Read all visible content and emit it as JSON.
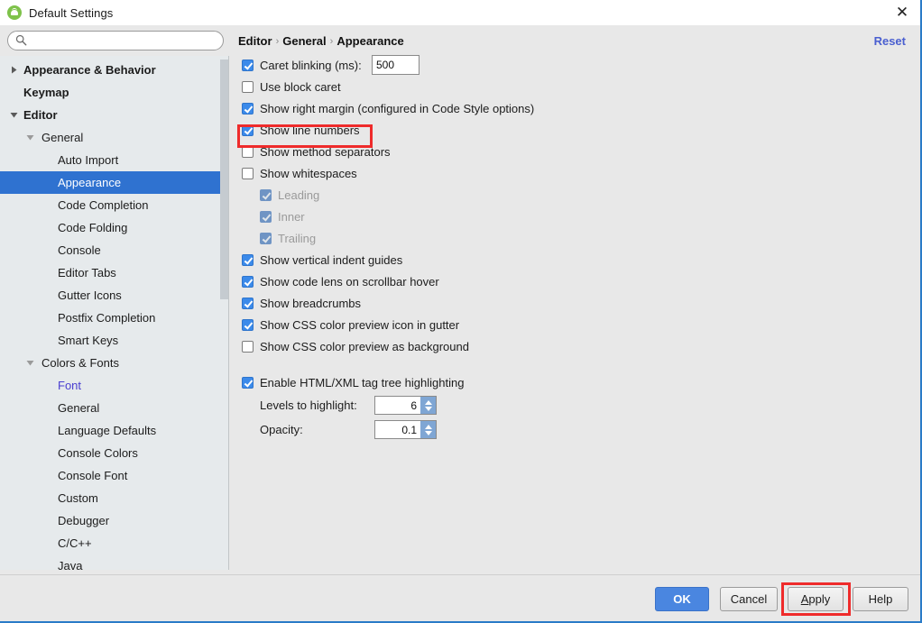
{
  "window": {
    "title": "Default Settings",
    "app_icon": "android-studio-icon",
    "close_icon": "close-icon",
    "accent_border": "#2a7bc8"
  },
  "search": {
    "value": "",
    "placeholder": "",
    "icon": "search-icon"
  },
  "sidebar": {
    "items": [
      {
        "label": "Appearance & Behavior",
        "indent": 0,
        "bold": true,
        "twisty": "collapsed",
        "selected": false,
        "link": false
      },
      {
        "label": "Keymap",
        "indent": 0,
        "bold": true,
        "twisty": "none",
        "selected": false,
        "link": false
      },
      {
        "label": "Editor",
        "indent": 0,
        "bold": true,
        "twisty": "expanded",
        "selected": false,
        "link": false
      },
      {
        "label": "General",
        "indent": 1,
        "bold": false,
        "twisty": "expanded",
        "selected": false,
        "link": false
      },
      {
        "label": "Auto Import",
        "indent": 2,
        "bold": false,
        "twisty": "none",
        "selected": false,
        "link": false
      },
      {
        "label": "Appearance",
        "indent": 2,
        "bold": false,
        "twisty": "none",
        "selected": true,
        "link": false
      },
      {
        "label": "Code Completion",
        "indent": 2,
        "bold": false,
        "twisty": "none",
        "selected": false,
        "link": false
      },
      {
        "label": "Code Folding",
        "indent": 2,
        "bold": false,
        "twisty": "none",
        "selected": false,
        "link": false
      },
      {
        "label": "Console",
        "indent": 2,
        "bold": false,
        "twisty": "none",
        "selected": false,
        "link": false
      },
      {
        "label": "Editor Tabs",
        "indent": 2,
        "bold": false,
        "twisty": "none",
        "selected": false,
        "link": false
      },
      {
        "label": "Gutter Icons",
        "indent": 2,
        "bold": false,
        "twisty": "none",
        "selected": false,
        "link": false
      },
      {
        "label": "Postfix Completion",
        "indent": 2,
        "bold": false,
        "twisty": "none",
        "selected": false,
        "link": false
      },
      {
        "label": "Smart Keys",
        "indent": 2,
        "bold": false,
        "twisty": "none",
        "selected": false,
        "link": false
      },
      {
        "label": "Colors & Fonts",
        "indent": 1,
        "bold": false,
        "twisty": "expanded",
        "selected": false,
        "link": false
      },
      {
        "label": "Font",
        "indent": 2,
        "bold": false,
        "twisty": "none",
        "selected": false,
        "link": true
      },
      {
        "label": "General",
        "indent": 2,
        "bold": false,
        "twisty": "none",
        "selected": false,
        "link": false
      },
      {
        "label": "Language Defaults",
        "indent": 2,
        "bold": false,
        "twisty": "none",
        "selected": false,
        "link": false
      },
      {
        "label": "Console Colors",
        "indent": 2,
        "bold": false,
        "twisty": "none",
        "selected": false,
        "link": false
      },
      {
        "label": "Console Font",
        "indent": 2,
        "bold": false,
        "twisty": "none",
        "selected": false,
        "link": false
      },
      {
        "label": "Custom",
        "indent": 2,
        "bold": false,
        "twisty": "none",
        "selected": false,
        "link": false
      },
      {
        "label": "Debugger",
        "indent": 2,
        "bold": false,
        "twisty": "none",
        "selected": false,
        "link": false
      },
      {
        "label": "C/C++",
        "indent": 2,
        "bold": false,
        "twisty": "none",
        "selected": false,
        "link": false
      },
      {
        "label": "Java",
        "indent": 2,
        "bold": false,
        "twisty": "none",
        "selected": false,
        "link": false
      }
    ]
  },
  "content": {
    "breadcrumb": [
      "Editor",
      "General",
      "Appearance"
    ],
    "breadcrumb_separator": "›",
    "reset_label": "Reset",
    "caret_blinking": {
      "label": "Caret blinking (ms):",
      "checked": true,
      "value": "500"
    },
    "options": [
      {
        "label": "Use block caret",
        "checked": false,
        "indent": 0,
        "disabled": false,
        "highlighted": false
      },
      {
        "label": "Show right margin (configured in Code Style options)",
        "checked": true,
        "indent": 0,
        "disabled": false,
        "highlighted": false
      },
      {
        "label": "Show line numbers",
        "checked": true,
        "indent": 0,
        "disabled": false,
        "highlighted": true
      },
      {
        "label": "Show method separators",
        "checked": false,
        "indent": 0,
        "disabled": false,
        "highlighted": false
      },
      {
        "label": "Show whitespaces",
        "checked": false,
        "indent": 0,
        "disabled": false,
        "highlighted": false
      },
      {
        "label": "Leading",
        "checked": true,
        "indent": 1,
        "disabled": true,
        "highlighted": false
      },
      {
        "label": "Inner",
        "checked": true,
        "indent": 1,
        "disabled": true,
        "highlighted": false
      },
      {
        "label": "Trailing",
        "checked": true,
        "indent": 1,
        "disabled": true,
        "highlighted": false
      },
      {
        "label": "Show vertical indent guides",
        "checked": true,
        "indent": 0,
        "disabled": false,
        "highlighted": false
      },
      {
        "label": "Show code lens on scrollbar hover",
        "checked": true,
        "indent": 0,
        "disabled": false,
        "highlighted": false
      },
      {
        "label": "Show breadcrumbs",
        "checked": true,
        "indent": 0,
        "disabled": false,
        "highlighted": false
      },
      {
        "label": "Show CSS color preview icon in gutter",
        "checked": true,
        "indent": 0,
        "disabled": false,
        "highlighted": false
      },
      {
        "label": "Show CSS color preview as background",
        "checked": false,
        "indent": 0,
        "disabled": false,
        "highlighted": false
      }
    ],
    "html_xml": {
      "enable_label": "Enable HTML/XML tag tree highlighting",
      "enable_checked": true,
      "levels_label": "Levels to highlight:",
      "levels_value": "6",
      "opacity_label": "Opacity:",
      "opacity_value": "0.1"
    }
  },
  "footer": {
    "buttons": [
      {
        "label": "OK",
        "primary": true,
        "underline_index": -1
      },
      {
        "label": "Cancel",
        "primary": false,
        "underline_index": -1
      },
      {
        "label": "Apply",
        "primary": false,
        "underline_index": 0
      },
      {
        "label": "Help",
        "primary": false,
        "underline_index": -1
      }
    ]
  },
  "annotations": {
    "highlight_color": "#ef2b2b",
    "boxes": [
      "show-line-numbers-row",
      "apply-button"
    ]
  }
}
